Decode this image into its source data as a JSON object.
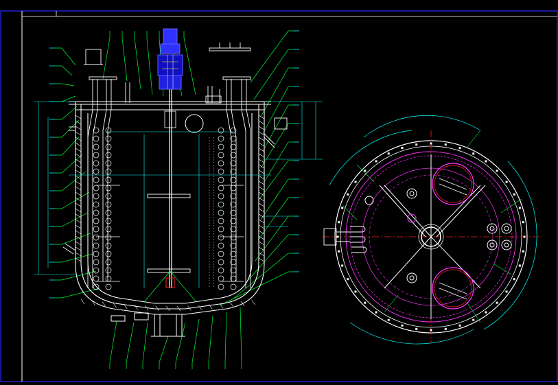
{
  "colors": {
    "background": "#000000",
    "frame": "#2a2aff",
    "outline": "#ffffff",
    "leader": "#00ff33",
    "dimension": "#00ffff",
    "centerline": "#ff2020",
    "flange": "#ff33ff",
    "motor": "#3030ff",
    "hatch": "#ffff00"
  },
  "icons": {
    "motor": "motor-icon",
    "agitator": "agitator-icon",
    "manhole": "manhole-icon",
    "nozzle": "nozzle-icon"
  },
  "views": [
    "front-section",
    "top-view"
  ]
}
